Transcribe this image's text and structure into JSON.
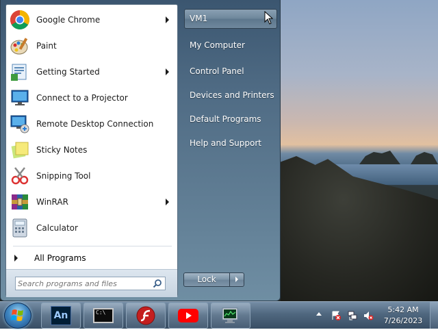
{
  "start_menu": {
    "programs": [
      {
        "label": "Google Chrome",
        "icon": "chrome-icon",
        "has_submenu": true
      },
      {
        "label": "Paint",
        "icon": "paint-icon",
        "has_submenu": false
      },
      {
        "label": "Getting Started",
        "icon": "getting-started-icon",
        "has_submenu": true
      },
      {
        "label": "Connect to a Projector",
        "icon": "projector-icon",
        "has_submenu": false
      },
      {
        "label": "Remote Desktop Connection",
        "icon": "remote-desktop-icon",
        "has_submenu": false
      },
      {
        "label": "Sticky Notes",
        "icon": "sticky-notes-icon",
        "has_submenu": false
      },
      {
        "label": "Snipping Tool",
        "icon": "snipping-tool-icon",
        "has_submenu": false
      },
      {
        "label": "WinRAR",
        "icon": "winrar-icon",
        "has_submenu": true
      },
      {
        "label": "Calculator",
        "icon": "calculator-icon",
        "has_submenu": false
      }
    ],
    "all_programs_label": "All Programs",
    "search_placeholder": "Search programs and files",
    "right_pane": {
      "user": "VM1",
      "links": [
        "My Computer",
        "Control Panel",
        "Devices and Printers",
        "Default Programs",
        "Help and Support"
      ]
    },
    "lock_label": "Lock"
  },
  "taskbar": {
    "pinned": [
      {
        "name": "animate",
        "icon": "adobe-animate-icon",
        "text": "An"
      },
      {
        "name": "cmd",
        "icon": "command-prompt-icon",
        "text": "C:\\"
      },
      {
        "name": "flash",
        "icon": "flash-player-icon",
        "text": ""
      },
      {
        "name": "youtube",
        "icon": "youtube-icon",
        "text": ""
      },
      {
        "name": "monitor",
        "icon": "resource-monitor-icon",
        "text": ""
      }
    ],
    "clock": {
      "time": "5:42 AM",
      "date": "7/26/2023"
    }
  },
  "colors": {
    "start_menu": "#4f6b84",
    "taskbar": "#3b5670",
    "accent": "#3f87c2"
  }
}
